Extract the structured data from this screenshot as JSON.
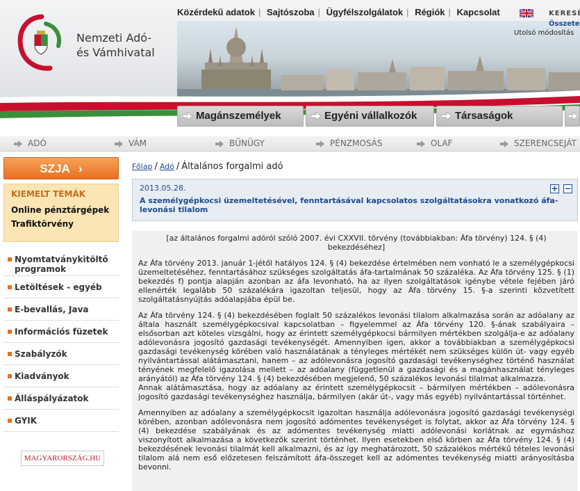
{
  "header": {
    "org_line1": "Nemzeti Adó-",
    "org_line2": "és Vámhivatal",
    "topnav": [
      "Közérdekű adatok",
      "Sajtószoba",
      "Ügyfélszolgálatok",
      "Régiók",
      "Kapcsolat"
    ],
    "search_label": "KERESÉ",
    "osszes": "Összete",
    "modositas": "Utolsó módosítás"
  },
  "main_tabs": [
    "Magánszemélyek",
    "Egyéni vállalkozók",
    "Társaságok"
  ],
  "sub_nav": [
    "ADÓ",
    "VÁM",
    "BŰNÜGY",
    "PÉNZMOSÁS",
    "OLAF",
    "SZERENCSEJÁT"
  ],
  "sidebar": {
    "szja_label": "SZJA",
    "kiemelt_title": "KIEMELT TÉMÁK",
    "kiemelt_items": [
      "Online pénztárgépek",
      "Trafiktörvény"
    ],
    "links": [
      "Nyomtatványkitöltő programok",
      "Letöltések - egyéb",
      "E-bevallás, Java",
      "Információs füzetek",
      "Szabályzók",
      "Kiadványok",
      "Álláspályázatok",
      "GYIK"
    ],
    "magyarorszag": "MAGYARORSZÁG.HU"
  },
  "breadcrumb": {
    "home": "Főlap",
    "section": "Adó",
    "current": "Általános forgalmi adó"
  },
  "article": {
    "date": "2013.05.28.",
    "title": "A személygépkocsi üzemeltetésével, fenntartásával kapcsolatos szolgáltatásokra vonatkozó áfa-levonási tilalom",
    "reference": "[az általános forgalmi adóról szóló 2007. évi CXXVII. törvény (továbbiakban: Áfa törvény) 124. § (4) bekezdéséhez]",
    "paragraphs": [
      "Az Áfa törvény 2013. január 1-jétől hatályos 124. § (4) bekezdése értelmében nem vonható le a személygépkocsi üzemeltetéséhez, fenntartásához szükséges szolgáltatás áfa-tartalmának 50 százaléka. Az Áfa törvény 125. § (1) bekezdés f) pontja alapján azonban az áfa levonható, ha az ilyen szolgáltatások igénybe vétele fejében járó ellenérték legalább 50 százalékára igazoltan teljesül, hogy az Áfa törvény 15. §-a szerinti közvetített szolgáltatásnyújtás adóalapjába épül be.",
      "Az Áfa törvény 124. § (4) bekezdésében foglalt 50 százalékos levonási tilalom alkalmazása során az adóalany az általa használt személygépkocsival kapcsolatban – figyelemmel az Áfa törvény 120. §-ának szabályaira – elsősorban azt köteles vizsgálni, hogy az érintett személygépkocsi bármilyen mértékben szolgálja-e az adóalany adólevonásra jogosító gazdasági tevékenységét. Amennyiben igen, akkor a továbbiakban a személygépkocsi gazdasági tevékenység körében való használatának a tényleges mértékét nem szükséges külön út- vagy egyéb nyilvántartással alátámasztani, hanem – az adólevonásra jogosító gazdasági tevékenységhez történő használat tényének megfelelő igazolása mellett – az adóalany (függetlenül a gazdasági és a magánhasználat tényleges arányától) az Áfa törvény 124. § (4) bekezdésében megjelenő, 50 százalékos levonási tilalmat alkalmazza.",
      "Annak alátámasztása, hogy az adóalany az érintett személygépkocsit – bármilyen mértékben – adólevonásra jogosító gazdasági tevékenységhez használja, bármilyen (akár út-, vagy más egyéb) nyilvántartással történhet.",
      "Amennyiben az adóalany a személygépkocsit igazoltan használja adólevonásra jogosító gazdasági tevékenységi körében, azonban adólevonásra nem jogosító adómentes tevékenységet is folytat, akkor az Áfa törvény 124. § (4) bekezdése szabályának és az adómentes tevékenység miatti adólevonási korlátnak az egymáshoz viszonyított alkalmazása a következők szerint történhet. Ilyen esetekben első körben az Áfa törvény 124. § (4) bekezdésének levonási tilalmát kell alkalmazni, és az így meghatározott, 50 százalékos mértékű tételes levonási tilalom alá nem eső előzetesen felszámított áfa-összeget kell az adómentes tevékenység miatti arányosításba bevonni."
    ]
  },
  "colors": {
    "accent_orange": "#e8701f",
    "link_blue": "#1b4a8f",
    "flag_red": "#c8102e",
    "flag_green": "#3a8f3a"
  }
}
